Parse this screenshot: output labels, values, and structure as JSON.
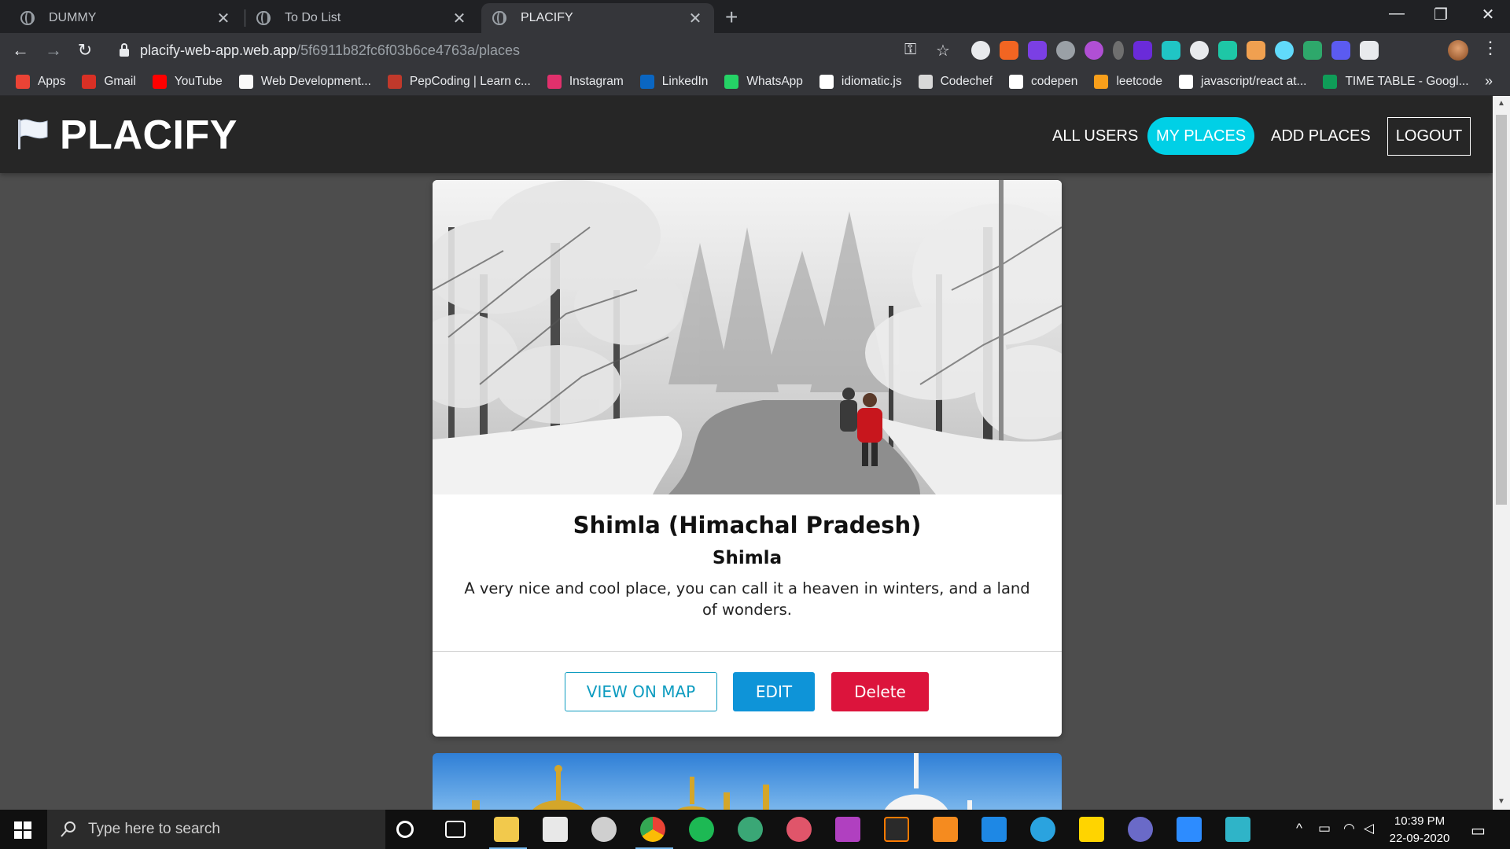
{
  "browser": {
    "tabs": [
      {
        "title": "DUMMY",
        "active": false
      },
      {
        "title": "To Do List",
        "active": false
      },
      {
        "title": "PLACIFY",
        "active": true
      }
    ],
    "url_host": "placify-web-app.web.app",
    "url_path": "/5f6911b82fc6f03b6ce4763a/places",
    "bookmarks": [
      {
        "label": "Apps",
        "icon": "apps-grid-icon",
        "color": "#ea4335"
      },
      {
        "label": "Gmail",
        "icon": "gmail-icon",
        "color": "#d93025"
      },
      {
        "label": "YouTube",
        "icon": "youtube-icon",
        "color": "#ff0000"
      },
      {
        "label": "Web Development...",
        "icon": "web-dev-icon",
        "color": "#f9f9f9"
      },
      {
        "label": "PepCoding | Learn c...",
        "icon": "pepcoding-icon",
        "color": "#c0392b"
      },
      {
        "label": "Instagram",
        "icon": "instagram-icon",
        "color": "#e1306c"
      },
      {
        "label": "LinkedIn",
        "icon": "linkedin-icon",
        "color": "#0a66c2"
      },
      {
        "label": "WhatsApp",
        "icon": "whatsapp-icon",
        "color": "#25d366"
      },
      {
        "label": "idiomatic.js",
        "icon": "github-icon",
        "color": "#ffffff"
      },
      {
        "label": "Codechef",
        "icon": "codechef-icon",
        "color": "#d8d8d8"
      },
      {
        "label": "codepen",
        "icon": "codepen-icon",
        "color": "#ffffff"
      },
      {
        "label": "leetcode",
        "icon": "leetcode-icon",
        "color": "#f89f1b"
      },
      {
        "label": "javascript/react at...",
        "icon": "github-icon",
        "color": "#ffffff"
      },
      {
        "label": "TIME TABLE - Googl...",
        "icon": "google-sheets-icon",
        "color": "#0f9d58"
      }
    ],
    "more_bookmarks": "»"
  },
  "app": {
    "brand": "PLACIFY",
    "nav": {
      "all_users": "ALL USERS",
      "my_places": "MY PLACES",
      "add_places": "ADD PLACES",
      "logout": "LOGOUT"
    },
    "accent_color": "#00d0e6"
  },
  "place": {
    "title": "Shimla (Himachal Pradesh)",
    "address": "Shimla",
    "description": "A very nice and cool place, you can call it a heaven in winters, and a land of wonders.",
    "actions": {
      "view_on_map": "VIEW ON MAP",
      "edit": "EDIT",
      "delete": "Delete"
    },
    "colors": {
      "map": "#0e9cc0",
      "edit": "#0e94d8",
      "delete": "#dc143c"
    }
  },
  "taskbar": {
    "search_placeholder": "Type here to search",
    "time": "10:39 PM",
    "date": "22-09-2020"
  }
}
